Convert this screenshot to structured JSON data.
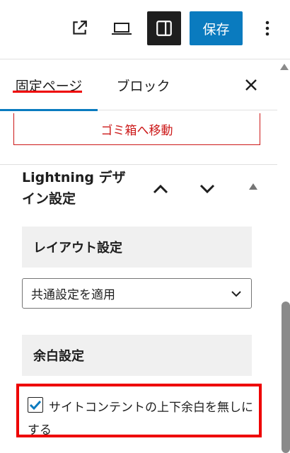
{
  "toolbar": {
    "save_label": "保存",
    "icons": [
      "external-link-icon",
      "laptop-preview-icon",
      "sidebar-toggle-icon",
      "more-options-icon"
    ]
  },
  "tabs": [
    {
      "label": "固定ページ"
    },
    {
      "label": "ブロック"
    }
  ],
  "trash_label": "ゴミ箱へ移動",
  "lightning_panel": {
    "title": "Lightning デザイン設定",
    "layout_section": "レイアウト設定",
    "layout_select_value": "共通設定を適用",
    "margin_section": "余白設定",
    "margin_checkbox_label": "サイトコンテントの上下余白を無しにする",
    "margin_checkbox_checked": true
  },
  "colors": {
    "accent": "#0a7bbf",
    "annotation": "#ee0000",
    "destructive": "#cc1818",
    "dark": "#1e1e1e"
  }
}
